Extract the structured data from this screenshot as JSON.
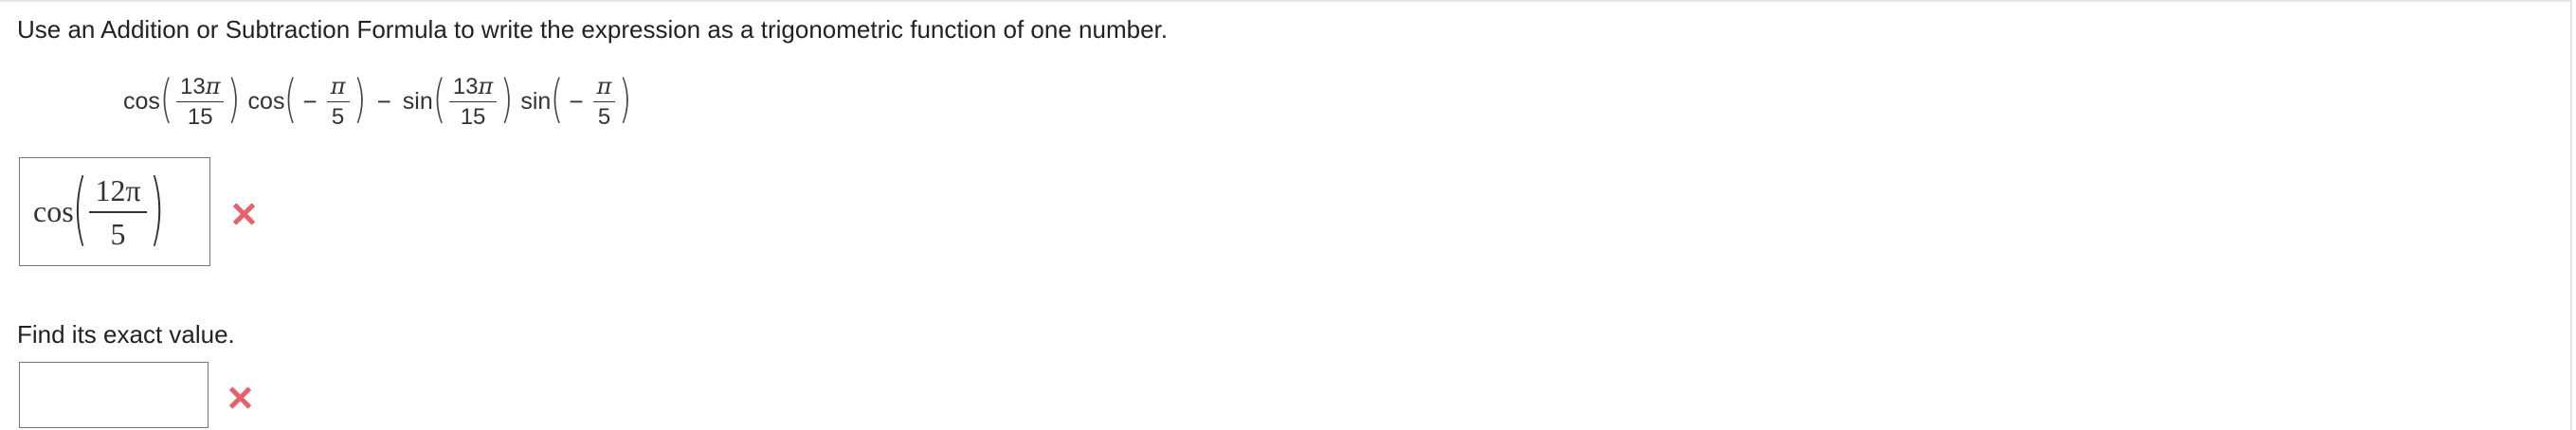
{
  "question": {
    "prompt": "Use an Addition or Subtraction Formula to write the expression as a trigonometric function of one number."
  },
  "expression": {
    "term1_fn": "cos",
    "term1_num": "13",
    "term1_den": "15",
    "term2_fn": "cos",
    "term2_sign": "−",
    "term2_num": "",
    "term2_den": "5",
    "operator": "−",
    "term3_fn": "sin",
    "term3_num": "13",
    "term3_den": "15",
    "term4_fn": "sin",
    "term4_sign": "−",
    "term4_num": "",
    "term4_den": "5",
    "pi": "π"
  },
  "answer1": {
    "fn": "cos",
    "num": "12π",
    "den": "5",
    "status": "incorrect"
  },
  "part2": {
    "label": "Find its exact value.",
    "value": "",
    "status": "incorrect"
  },
  "colors": {
    "incorrect": "#e8606a",
    "box_border": "#777777"
  },
  "icons": {
    "incorrect": "x-mark-icon"
  }
}
